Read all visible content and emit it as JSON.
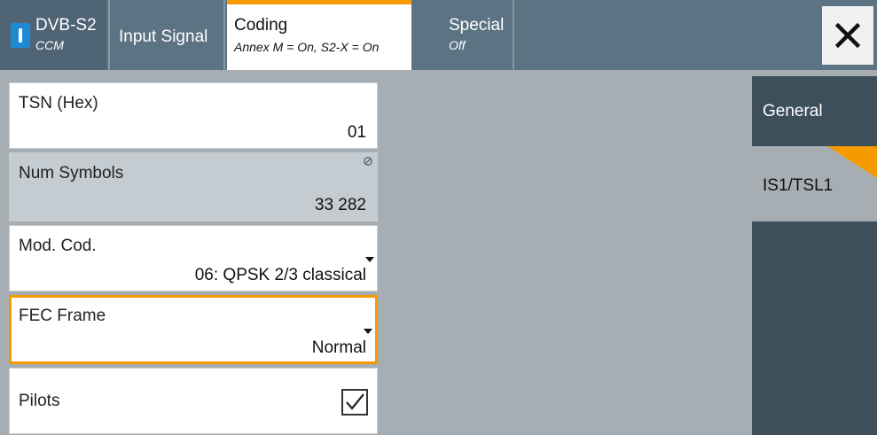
{
  "tabs": {
    "dvbs2": {
      "title": "DVB-S2",
      "subtitle": "CCM"
    },
    "input_signal": {
      "title": "Input Signal"
    },
    "coding": {
      "title": "Coding",
      "subtitle": "Annex M = On, S2-X = On"
    },
    "special": {
      "title": "Special",
      "subtitle": "Off"
    }
  },
  "fields": {
    "tsn": {
      "label": "TSN (Hex)",
      "value": "01"
    },
    "num_symbols": {
      "label": "Num Symbols",
      "value": "33 282"
    },
    "mod_cod": {
      "label": "Mod. Cod.",
      "value": "06: QPSK 2/3 classical"
    },
    "fec_frame": {
      "label": "FEC Frame",
      "value": "Normal"
    },
    "pilots": {
      "label": "Pilots",
      "checked": true
    }
  },
  "side_nav": {
    "general": "General",
    "is1_tsl1": "IS1/TSL1"
  },
  "colors": {
    "accent": "#f59a00",
    "tab_bar": "#5c7384",
    "on_indicator": "#1e8ad6",
    "side_nav_dark": "#3e4f5c",
    "background": "#a7aeb3"
  }
}
